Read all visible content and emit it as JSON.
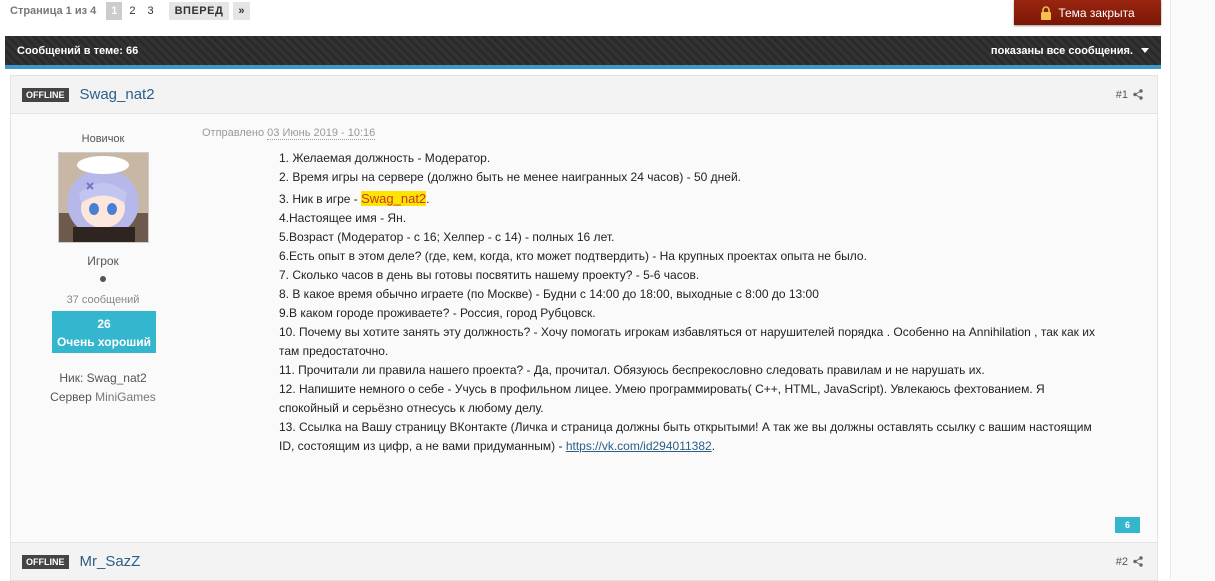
{
  "pagination": {
    "label": "Страница 1 из 4",
    "pages": [
      "1",
      "2",
      "3"
    ],
    "next_label": "ВПЕРЕД",
    "last_label": "»"
  },
  "closed_button": {
    "label": "Тема закрыта",
    "icon": "lock-icon"
  },
  "topic_bar": {
    "count_label": "Сообщений в теме: 66",
    "filter_label": "показаны все сообщения."
  },
  "posts": [
    {
      "status": "OFFLINE",
      "author": "Swag_nat2",
      "number": "#1",
      "rank_title": "Новичок",
      "group": "Игрок",
      "posts_count": "37 сообщений",
      "reputation_value": "26",
      "reputation_label": "Очень хороший",
      "nick_label": "Ник: Swag_nat2",
      "server_label": "Сервер",
      "server_value": "MiniGames",
      "posted_prefix": "Отправлено",
      "posted_date": "03 Июнь 2019 - 10:16",
      "lines": [
        "1. Желаемая должность - Модератор.",
        "2. Время игры на сервере (должно быть не менее наигранных 24 часов) - 50 дней.",
        "4.Настоящее имя - Ян.",
        "5.Возраст (Модератор - с 16; Хелпер - с 14) - полных 16 лет.",
        "6.Есть опыт в этом деле? (где, кем, когда, кто может подтвердить) - На крупных проектах опыта не было.",
        "7. Сколько часов в день вы готовы посвятить нашему проекту? - 5-6 часов.",
        "8. В какое время обычно играете (по Москве) - Будни с 14:00 до 18:00, выходные с 8:00 до 13:00",
        "9.В каком городе проживаете? - Россия, город Рубцовск.",
        "10. Почему вы хотите занять эту должность? - Хочу помогать игрокам избавляться от нарушителей порядка . Особенно на Annihilation , так как их там предостаточно.",
        "11. Прочитали ли правила нашего проекта? - Да, прочитал. Обязуюсь беспрекословно следовать правилам и не нарушать их.",
        "12. Напишите немного о себе - Учусь в профильном лицее. Умею программировать( C++, HTML, JavaScript). Увлекаюсь фехтованием. Я спокойный и серьёзно отнесусь к любому делу."
      ],
      "line3_prefix": "3. Ник в игре - ",
      "line3_highlight": "Swag_nat2",
      "line3_suffix": ".",
      "line13_text": "13. Ссылка на Вашу страницу ВКонтакте (Личка и страница должны быть открытыми! А так же вы должны оставлять ссылку с вашим настоящим ID, состоящим из цифр, а не вами придуманным) - ",
      "line13_link": "https://vk.com/id294011382",
      "line13_suffix": ".",
      "rep_badge": "6"
    },
    {
      "status": "OFFLINE",
      "author": "Mr_SazZ",
      "number": "#2"
    }
  ],
  "colors": {
    "accent": "#35b6cf",
    "closed_button": "#8b1c0a",
    "highlight": "#ffe400",
    "link": "#2b5f86"
  }
}
